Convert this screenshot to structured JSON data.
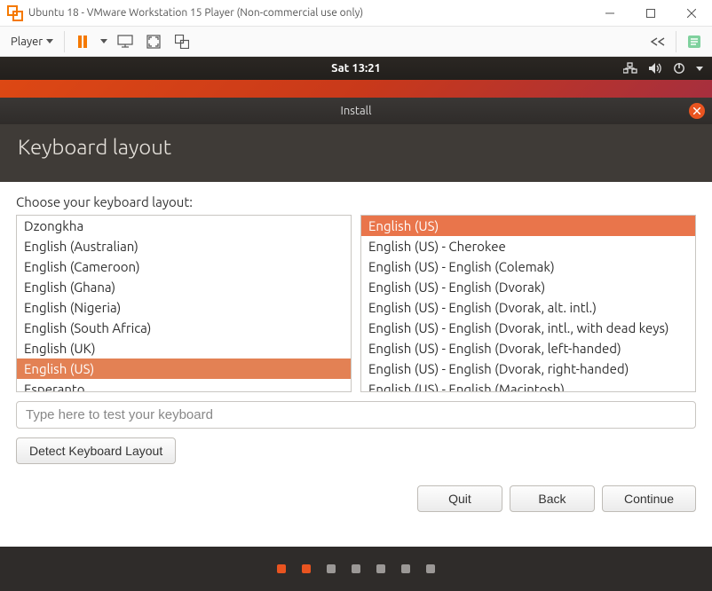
{
  "window": {
    "title": "Ubuntu 18 - VMware Workstation 15 Player (Non-commercial use only)"
  },
  "vmware_toolbar": {
    "player_menu": "Player"
  },
  "ubuntu_topbar": {
    "clock": "Sat 13:21"
  },
  "installer": {
    "title": "Install",
    "heading": "Keyboard layout",
    "prompt": "Choose your keyboard layout:",
    "left_list": {
      "items": [
        "Dzongkha",
        "English (Australian)",
        "English (Cameroon)",
        "English (Ghana)",
        "English (Nigeria)",
        "English (South Africa)",
        "English (UK)",
        "English (US)",
        "Esperanto"
      ],
      "selected_index": 7
    },
    "right_list": {
      "items": [
        "English (US)",
        "English (US) - Cherokee",
        "English (US) - English (Colemak)",
        "English (US) - English (Dvorak)",
        "English (US) - English (Dvorak, alt. intl.)",
        "English (US) - English (Dvorak, intl., with dead keys)",
        "English (US) - English (Dvorak, left-handed)",
        "English (US) - English (Dvorak, right-handed)",
        "English (US) - English (Macintosh)"
      ],
      "selected_index": 0
    },
    "test_placeholder": "Type here to test your keyboard",
    "detect_label": "Detect Keyboard Layout",
    "buttons": {
      "quit": "Quit",
      "back": "Back",
      "continue": "Continue"
    },
    "progress": {
      "total": 7,
      "active": [
        0,
        1
      ]
    }
  }
}
